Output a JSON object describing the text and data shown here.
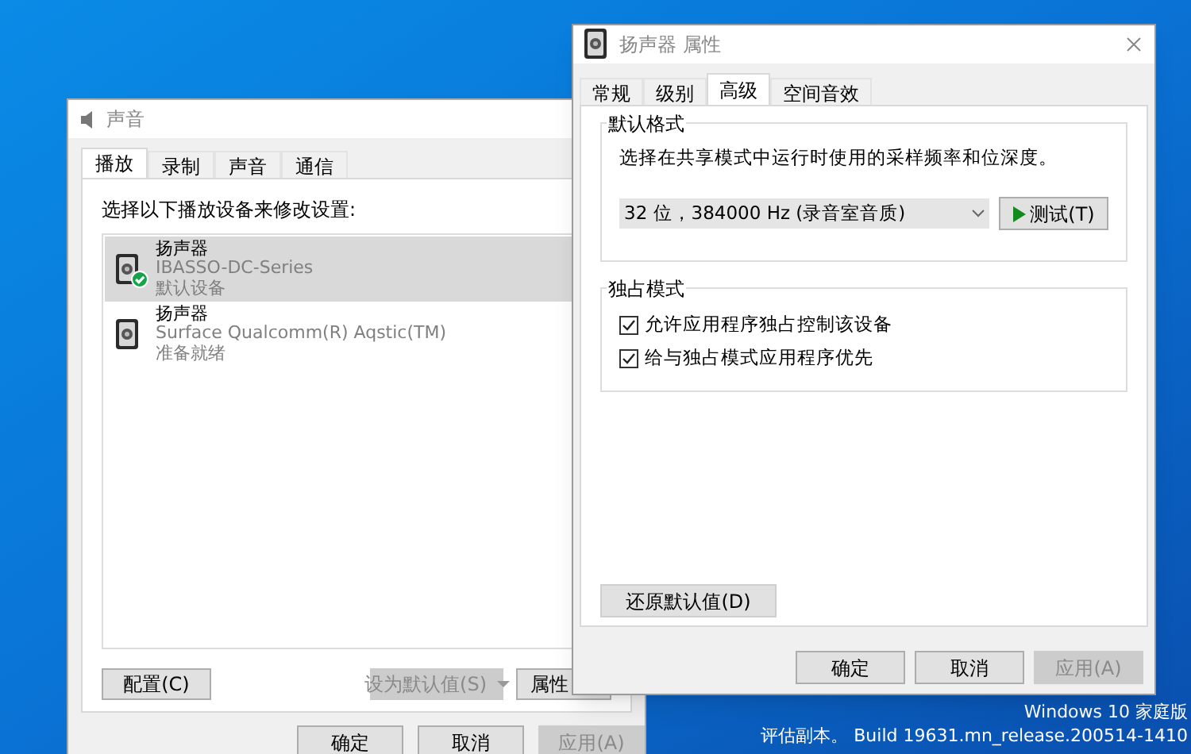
{
  "desktop": {
    "watermark_lines": [
      "Windows 10 家庭版",
      "评估副本。 Build 19631.mn_release.200514-1410"
    ]
  },
  "sound_window": {
    "title": "声音",
    "tabs": [
      {
        "label": "播放",
        "selected": true
      },
      {
        "label": "录制",
        "selected": false
      },
      {
        "label": "声音",
        "selected": false
      },
      {
        "label": "通信",
        "selected": false
      }
    ],
    "prompt": "选择以下播放设备来修改设置:",
    "devices": [
      {
        "name": "扬声器",
        "description": "IBASSO-DC-Series",
        "status": "默认设备",
        "default": true,
        "selected": true
      },
      {
        "name": "扬声器",
        "description": "Surface Qualcomm(R) Aqstic(TM)",
        "status": "准备就绪",
        "default": false,
        "selected": false
      }
    ],
    "buttons": [
      {
        "label": "配置(C)",
        "disabled": false,
        "kind": "plain"
      },
      {
        "label": "设为默认值(S)",
        "disabled": true,
        "kind": "split"
      },
      {
        "label": "属性",
        "disabled": false,
        "kind": "plain"
      }
    ],
    "dialog_buttons": [
      {
        "label": "确定",
        "disabled": false
      },
      {
        "label": "取消",
        "disabled": false
      },
      {
        "label": "应用(A)",
        "disabled": true
      }
    ]
  },
  "properties_window": {
    "title": "扬声器 属性",
    "tabs": [
      {
        "label": "常规",
        "selected": false
      },
      {
        "label": "级别",
        "selected": false
      },
      {
        "label": "高级",
        "selected": true
      },
      {
        "label": "空间音效",
        "selected": false
      }
    ],
    "default_format": {
      "heading": "默认格式",
      "description": "选择在共享模式中运行时使用的采样频率和位深度。",
      "format_value": "32 位，384000 Hz (录音室音质)",
      "test_button": "测试(T)"
    },
    "exclusive_mode": {
      "heading": "独占模式",
      "options": [
        {
          "label": "允许应用程序独占控制该设备",
          "checked": true
        },
        {
          "label": "给与独占模式应用程序优先",
          "checked": true
        }
      ]
    },
    "restore_button": "还原默认值(D)",
    "dialog_buttons": [
      {
        "label": "确定",
        "disabled": false
      },
      {
        "label": "取消",
        "disabled": false
      },
      {
        "label": "应用(A)",
        "disabled": true
      }
    ]
  }
}
